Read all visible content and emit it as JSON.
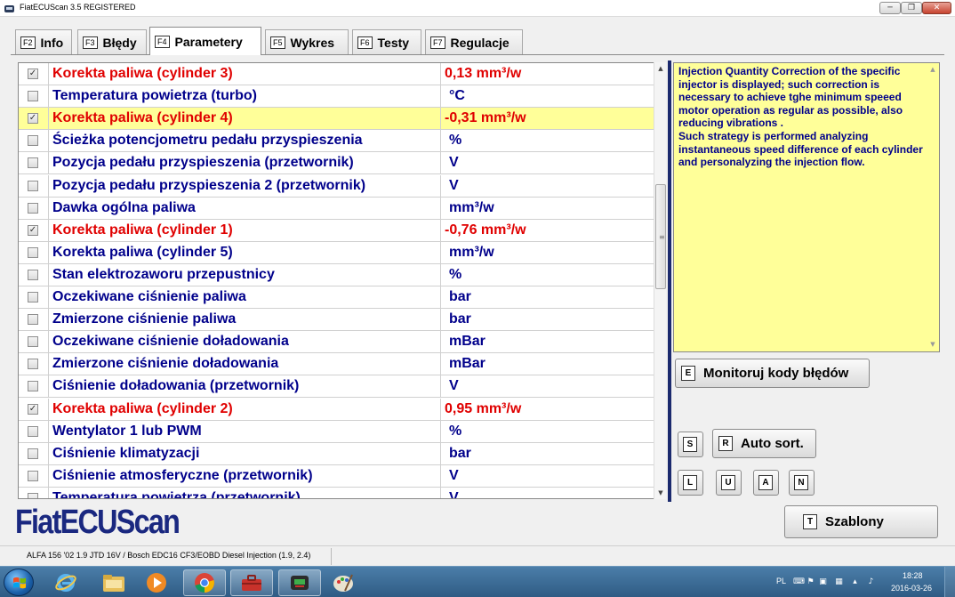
{
  "window": {
    "title": "FiatECUScan 3.5 REGISTERED"
  },
  "tabs": [
    {
      "key": "F2",
      "label": "Info"
    },
    {
      "key": "F3",
      "label": "Błędy"
    },
    {
      "key": "F4",
      "label": "Parametery"
    },
    {
      "key": "F5",
      "label": "Wykres"
    },
    {
      "key": "F6",
      "label": "Testy"
    },
    {
      "key": "F7",
      "label": "Regulacje"
    }
  ],
  "parameters": [
    {
      "checked": true,
      "selected": false,
      "name": "Korekta paliwa (cylinder 3)",
      "value": "0,13 mm³/w"
    },
    {
      "checked": false,
      "selected": false,
      "name": "Temperatura powietrza (turbo)",
      "value": "°C"
    },
    {
      "checked": true,
      "selected": true,
      "name": "Korekta paliwa (cylinder 4)",
      "value": "-0,31 mm³/w"
    },
    {
      "checked": false,
      "selected": false,
      "name": "Ścieżka potencjometru pedału przyspieszenia",
      "value": "%"
    },
    {
      "checked": false,
      "selected": false,
      "name": "Pozycja pedału przyspieszenia (przetwornik)",
      "value": "V"
    },
    {
      "checked": false,
      "selected": false,
      "name": "Pozycja pedału przyspieszenia 2 (przetwornik)",
      "value": "V"
    },
    {
      "checked": false,
      "selected": false,
      "name": "Dawka ogólna paliwa",
      "value": "mm³/w"
    },
    {
      "checked": true,
      "selected": false,
      "name": "Korekta paliwa (cylinder 1)",
      "value": "-0,76 mm³/w"
    },
    {
      "checked": false,
      "selected": false,
      "name": "Korekta paliwa (cylinder 5)",
      "value": "mm³/w"
    },
    {
      "checked": false,
      "selected": false,
      "name": "Stan elektrozaworu przepustnicy",
      "value": "%"
    },
    {
      "checked": false,
      "selected": false,
      "name": "Oczekiwane ciśnienie paliwa",
      "value": "bar"
    },
    {
      "checked": false,
      "selected": false,
      "name": "Zmierzone ciśnienie paliwa",
      "value": "bar"
    },
    {
      "checked": false,
      "selected": false,
      "name": "Oczekiwane ciśnienie doładowania",
      "value": "mBar"
    },
    {
      "checked": false,
      "selected": false,
      "name": "Zmierzone ciśnienie doładowania",
      "value": "mBar"
    },
    {
      "checked": false,
      "selected": false,
      "name": "Ciśnienie doładowania (przetwornik)",
      "value": "V"
    },
    {
      "checked": true,
      "selected": false,
      "name": "Korekta paliwa (cylinder 2)",
      "value": "0,95 mm³/w"
    },
    {
      "checked": false,
      "selected": false,
      "name": "Wentylator 1 lub PWM",
      "value": "%"
    },
    {
      "checked": false,
      "selected": false,
      "name": "Ciśnienie klimatyzacji",
      "value": "bar"
    },
    {
      "checked": false,
      "selected": false,
      "name": "Ciśnienie atmosferyczne (przetwornik)",
      "value": "V"
    },
    {
      "checked": false,
      "selected": false,
      "name": "Temperatura powietrza (przetwornik)",
      "value": "V"
    }
  ],
  "description": "Injection Quantity Correction of the specific injector is displayed; such correction is necessary to achieve tghe minimum speeed motor operation as regular as possible, also reducing vibrations .\nSuch strategy is performed analyzing instantaneous speed difference of each cylinder and personalyzing the injection flow.",
  "buttons": {
    "monitor": {
      "key": "E",
      "label": "Monitoruj kody błędów"
    },
    "s": {
      "key": "S"
    },
    "autosort": {
      "key": "R",
      "label": "Auto sort."
    },
    "l": {
      "key": "L"
    },
    "u": {
      "key": "U"
    },
    "a": {
      "key": "A"
    },
    "n": {
      "key": "N"
    },
    "templates": {
      "key": "T",
      "label": "Szablony"
    }
  },
  "logo": "FiatECUScan",
  "status": {
    "vehicle": "ALFA 156 '02 1.9 JTD 16V / Bosch EDC16 CF3/EOBD Diesel Injection (1.9, 2.4)"
  },
  "taskbar": {
    "apps": [
      "internet-explorer-icon",
      "file-explorer-icon",
      "media-player-icon",
      "chrome-icon",
      "toolbox-icon",
      "fiatecuscan-icon",
      "paint-icon"
    ],
    "language": "PL",
    "time": "18:28",
    "date": "2016-03-26"
  },
  "colors": {
    "active_param": "#e00000",
    "param": "#00008b",
    "selected_row": "#ffff99",
    "logo": "#1a2880"
  }
}
